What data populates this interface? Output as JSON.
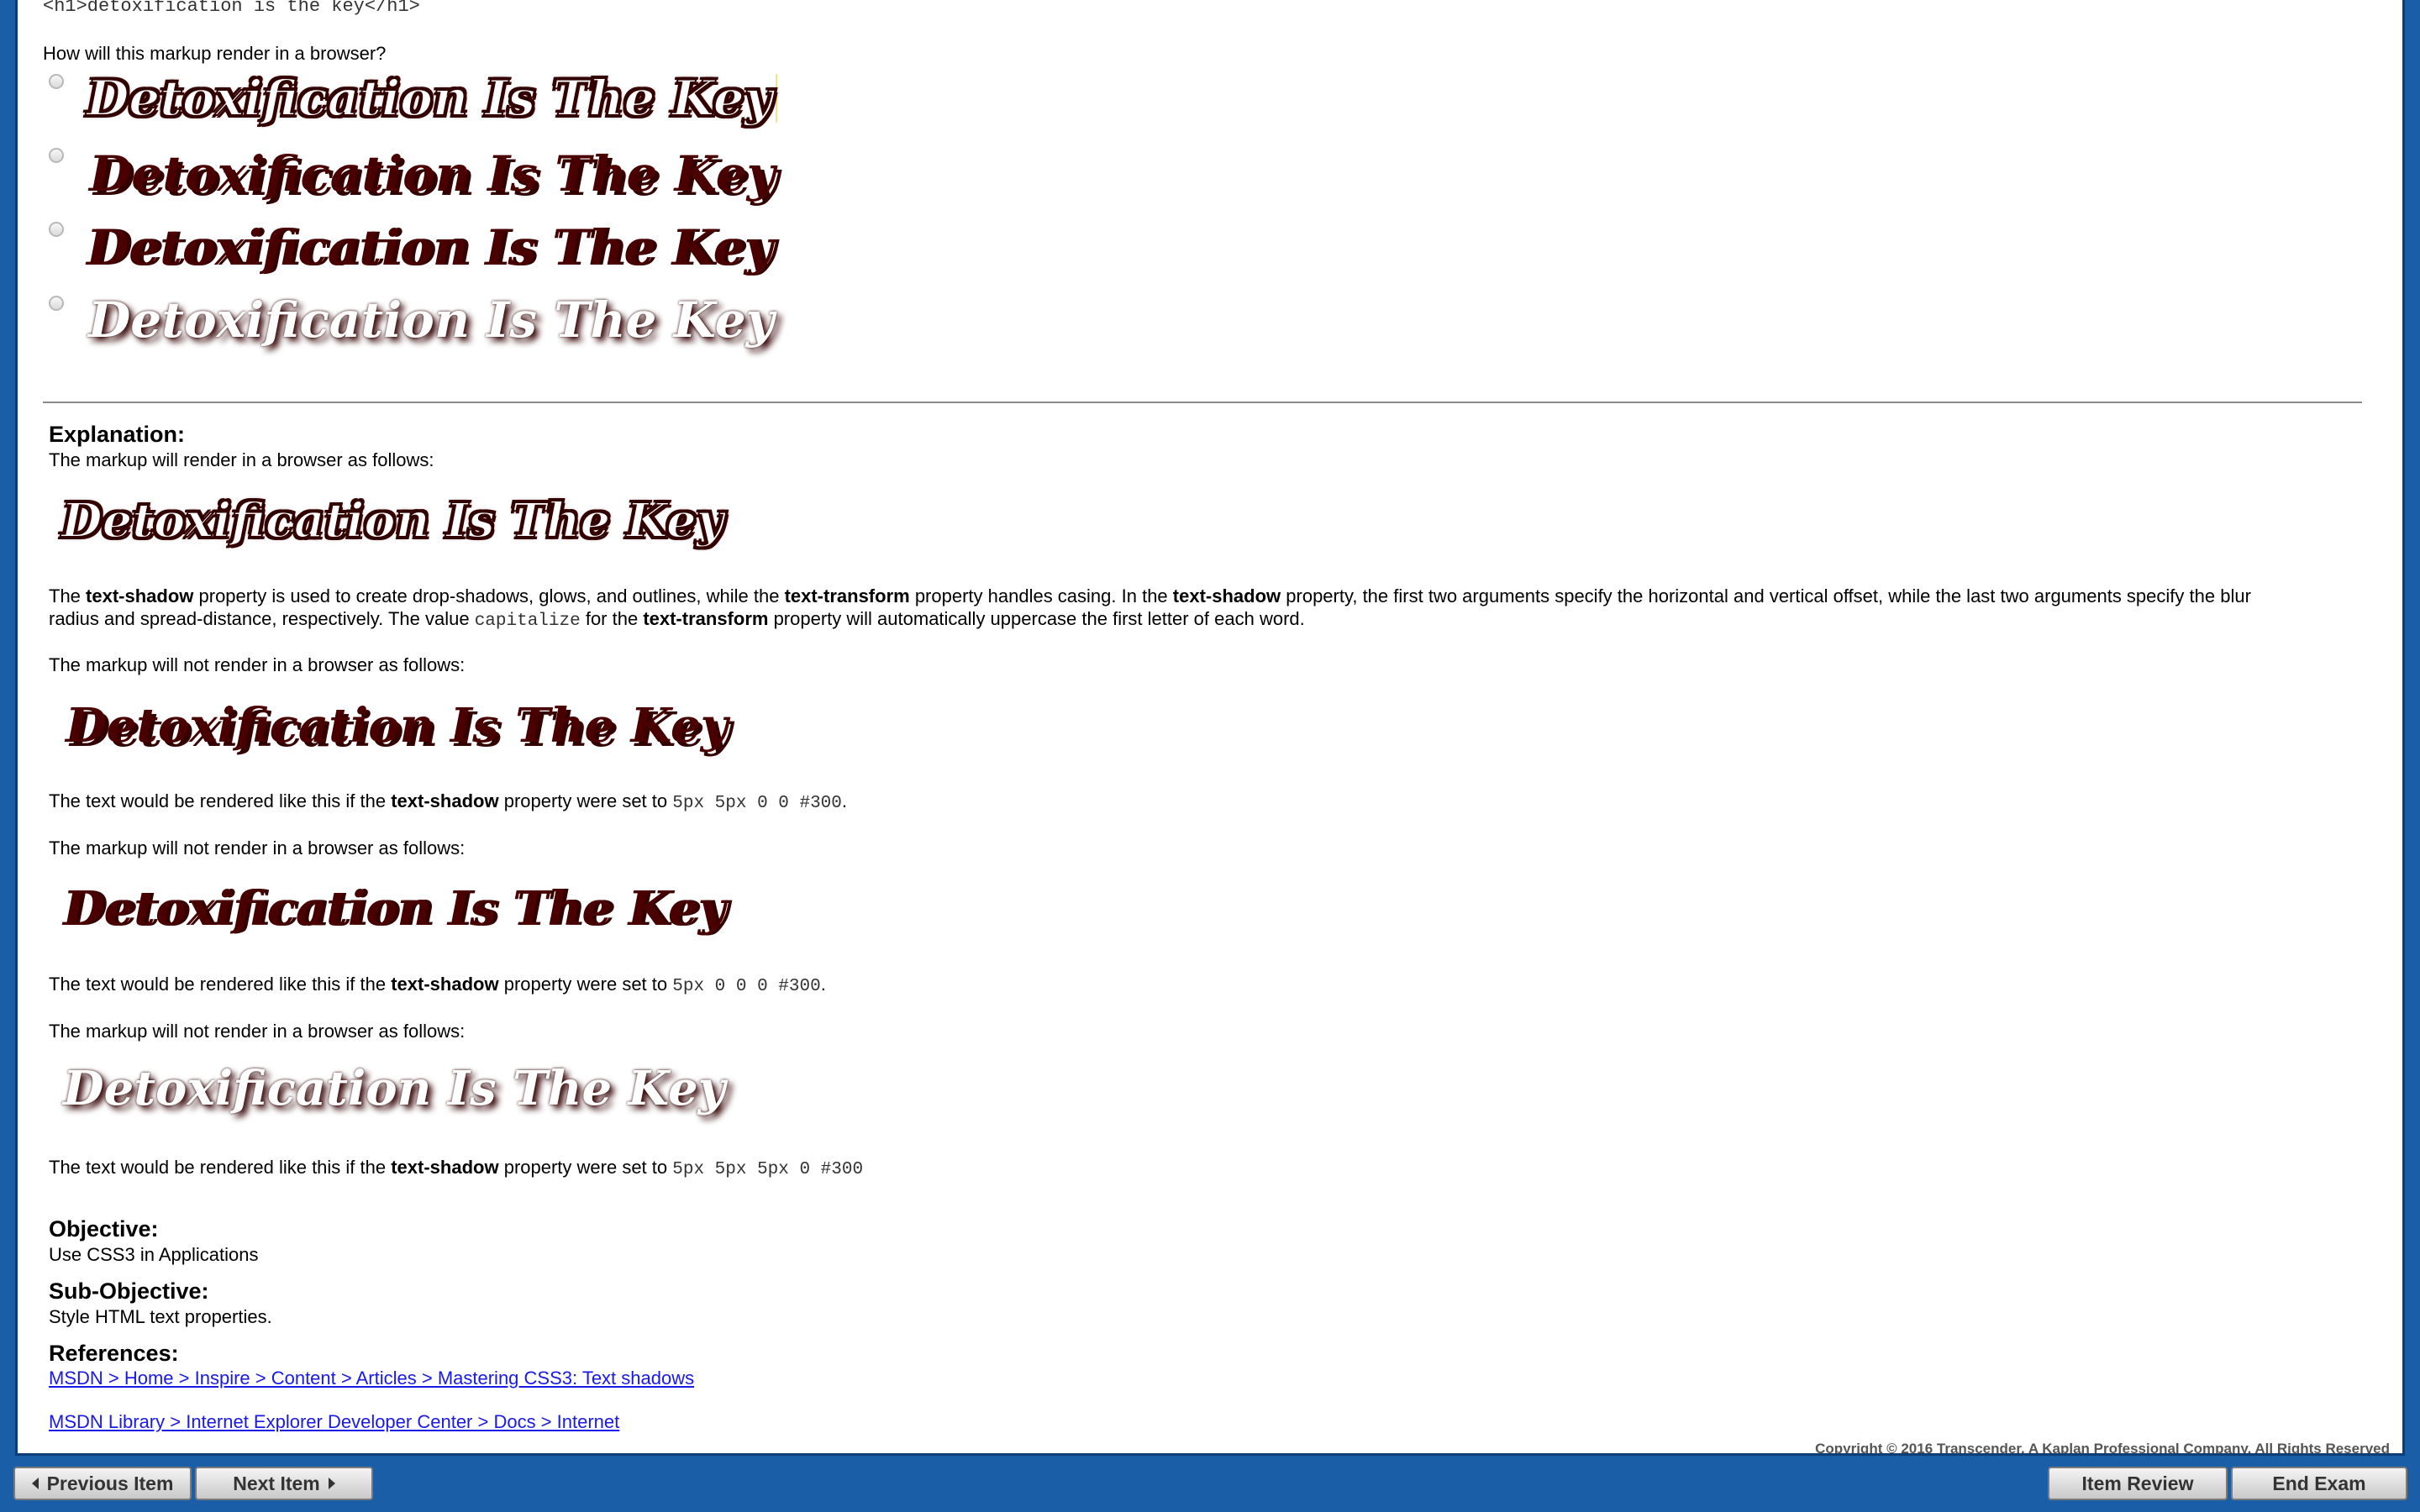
{
  "question": {
    "markup_code": "<h1>detoxification is the key</h1>",
    "prompt": "How will this markup render in a browser?",
    "options": [
      {
        "text": "Detoxification Is The Key"
      },
      {
        "text": "Detoxification Is The Key"
      },
      {
        "text": "Detoxification Is The Key"
      },
      {
        "text": "Detoxification Is The Key"
      }
    ]
  },
  "explanation": {
    "heading": "Explanation:",
    "intro": "The markup will render in a browser as follows:",
    "correct_render": "Detoxification Is The Key",
    "p1": {
      "t1": "The ",
      "b1": "text-shadow",
      "t2": " property is used to create drop-shadows, glows, and outlines, while the ",
      "b2": "text-transform",
      "t3": " property handles casing. In the ",
      "b3": "text-shadow",
      "t4": " property, the first two arguments specify the horizontal and vertical offset, while the last two arguments specify the blur radius and spread-distance, respectively. The value ",
      "code": "capitalize",
      "t5": " for the ",
      "b4": "text-transform",
      "t6": " property will automatically uppercase the first letter of each word."
    },
    "wrong": [
      {
        "intro": "The markup will not render in a browser as follows:",
        "render": "Detoxification Is The Key",
        "t1": "The text would be rendered like this if the ",
        "bold": "text-shadow",
        "t2": " property were set to ",
        "code": "5px 5px 0 0 #300",
        "end": "."
      },
      {
        "intro": "The markup will not render in a browser as follows:",
        "render": "Detoxification Is The Key",
        "t1": "The text would be rendered like this if the ",
        "bold": "text-shadow",
        "t2": " property were set to ",
        "code": "5px 0 0 0 #300",
        "end": "."
      },
      {
        "intro": "The markup will not render in a browser as follows:",
        "render": "Detoxification Is The Key",
        "t1": "The text would be rendered like this if the ",
        "bold": "text-shadow",
        "t2": " property were set to ",
        "code": "5px 5px 5px 0 #300",
        "end": ""
      }
    ]
  },
  "objective": {
    "heading": "Objective:",
    "value": "Use CSS3 in Applications"
  },
  "sub_objective": {
    "heading": "Sub-Objective:",
    "value": "Style HTML text properties."
  },
  "references": {
    "heading": "References:",
    "links": [
      "MSDN > Home > Inspire > Content > Articles > Mastering CSS3: Text shadows",
      "MSDN Library > Internet Explorer Developer Center > Docs > Internet"
    ]
  },
  "copyright": "Copyright © 2016 Transcender, A Kaplan Professional Company. All Rights Reserved",
  "footer": {
    "prev": "Previous Item",
    "next": "Next Item",
    "review": "Item Review",
    "end": "End Exam"
  }
}
